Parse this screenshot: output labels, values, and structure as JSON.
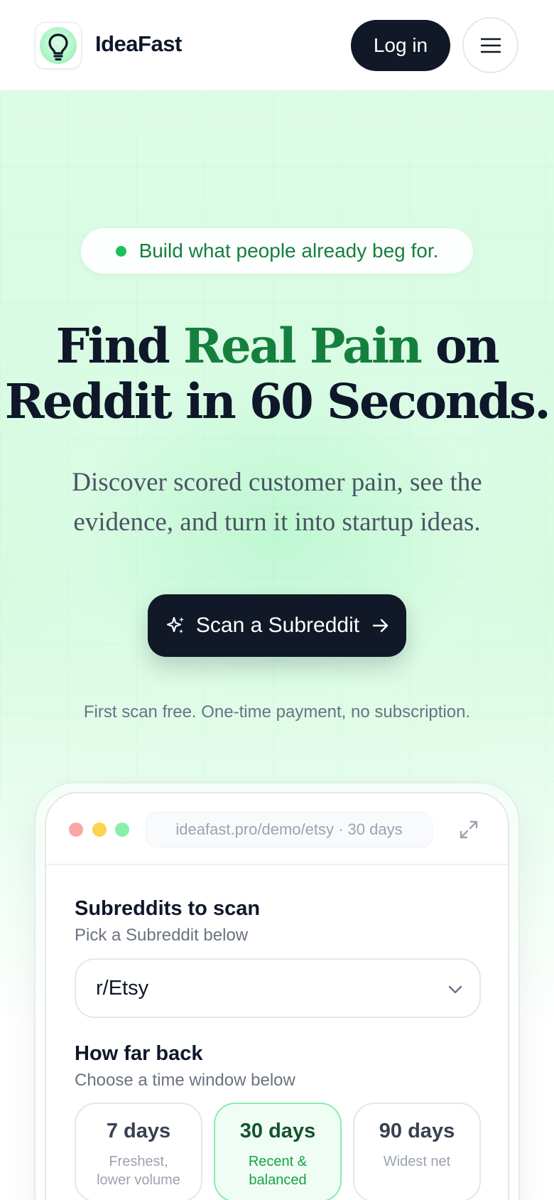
{
  "header": {
    "brand": "IdeaFast",
    "login_label": "Log in",
    "logo_icon": "lightbulb-icon",
    "menu_icon": "hamburger-menu-icon"
  },
  "hero": {
    "badge": "Build what people already beg for.",
    "headline_part1": "Find ",
    "headline_accent": "Real Pain",
    "headline_part2": " on",
    "headline_line2": "Reddit in 60 Seconds.",
    "subhead": "Discover scored customer pain, see the evidence, and turn it into startup ideas.",
    "cta_label": "Scan a Subreddit",
    "cta_icons": [
      "sparkles-icon",
      "arrow-right-icon"
    ],
    "fineprint": "First scan free. One-time payment, no subscription."
  },
  "demo": {
    "url": "ideafast.pro/demo/etsy · 30 days",
    "subreddits_title": "Subreddits to scan",
    "subreddits_sub": "Pick a Subreddit below",
    "selected_subreddit": "r/Etsy",
    "timeframe_title": "How far back",
    "timeframe_sub": "Choose a time window below",
    "options": [
      {
        "label": "7 days",
        "desc_line1": "Freshest,",
        "desc_line2": "lower volume",
        "selected": false
      },
      {
        "label": "30 days",
        "desc_line1": "Recent &",
        "desc_line2": "balanced",
        "selected": true
      },
      {
        "label": "90 days",
        "desc_line1": "Widest net",
        "desc_line2": "",
        "selected": false
      }
    ]
  },
  "colors": {
    "accent_green": "#15803d",
    "dark": "#111827",
    "hero_bg": "#dcfce7"
  }
}
